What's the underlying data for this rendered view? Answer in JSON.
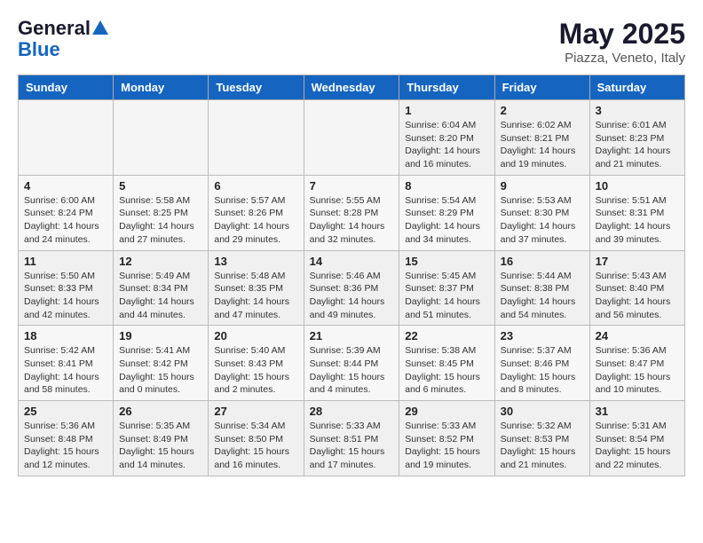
{
  "logo": {
    "line1": "General",
    "line2": "Blue"
  },
  "header": {
    "month": "May 2025",
    "location": "Piazza, Veneto, Italy"
  },
  "days_of_week": [
    "Sunday",
    "Monday",
    "Tuesday",
    "Wednesday",
    "Thursday",
    "Friday",
    "Saturday"
  ],
  "weeks": [
    [
      {
        "day": "",
        "info": ""
      },
      {
        "day": "",
        "info": ""
      },
      {
        "day": "",
        "info": ""
      },
      {
        "day": "",
        "info": ""
      },
      {
        "day": "1",
        "info": "Sunrise: 6:04 AM\nSunset: 8:20 PM\nDaylight: 14 hours\nand 16 minutes."
      },
      {
        "day": "2",
        "info": "Sunrise: 6:02 AM\nSunset: 8:21 PM\nDaylight: 14 hours\nand 19 minutes."
      },
      {
        "day": "3",
        "info": "Sunrise: 6:01 AM\nSunset: 8:23 PM\nDaylight: 14 hours\nand 21 minutes."
      }
    ],
    [
      {
        "day": "4",
        "info": "Sunrise: 6:00 AM\nSunset: 8:24 PM\nDaylight: 14 hours\nand 24 minutes."
      },
      {
        "day": "5",
        "info": "Sunrise: 5:58 AM\nSunset: 8:25 PM\nDaylight: 14 hours\nand 27 minutes."
      },
      {
        "day": "6",
        "info": "Sunrise: 5:57 AM\nSunset: 8:26 PM\nDaylight: 14 hours\nand 29 minutes."
      },
      {
        "day": "7",
        "info": "Sunrise: 5:55 AM\nSunset: 8:28 PM\nDaylight: 14 hours\nand 32 minutes."
      },
      {
        "day": "8",
        "info": "Sunrise: 5:54 AM\nSunset: 8:29 PM\nDaylight: 14 hours\nand 34 minutes."
      },
      {
        "day": "9",
        "info": "Sunrise: 5:53 AM\nSunset: 8:30 PM\nDaylight: 14 hours\nand 37 minutes."
      },
      {
        "day": "10",
        "info": "Sunrise: 5:51 AM\nSunset: 8:31 PM\nDaylight: 14 hours\nand 39 minutes."
      }
    ],
    [
      {
        "day": "11",
        "info": "Sunrise: 5:50 AM\nSunset: 8:33 PM\nDaylight: 14 hours\nand 42 minutes."
      },
      {
        "day": "12",
        "info": "Sunrise: 5:49 AM\nSunset: 8:34 PM\nDaylight: 14 hours\nand 44 minutes."
      },
      {
        "day": "13",
        "info": "Sunrise: 5:48 AM\nSunset: 8:35 PM\nDaylight: 14 hours\nand 47 minutes."
      },
      {
        "day": "14",
        "info": "Sunrise: 5:46 AM\nSunset: 8:36 PM\nDaylight: 14 hours\nand 49 minutes."
      },
      {
        "day": "15",
        "info": "Sunrise: 5:45 AM\nSunset: 8:37 PM\nDaylight: 14 hours\nand 51 minutes."
      },
      {
        "day": "16",
        "info": "Sunrise: 5:44 AM\nSunset: 8:38 PM\nDaylight: 14 hours\nand 54 minutes."
      },
      {
        "day": "17",
        "info": "Sunrise: 5:43 AM\nSunset: 8:40 PM\nDaylight: 14 hours\nand 56 minutes."
      }
    ],
    [
      {
        "day": "18",
        "info": "Sunrise: 5:42 AM\nSunset: 8:41 PM\nDaylight: 14 hours\nand 58 minutes."
      },
      {
        "day": "19",
        "info": "Sunrise: 5:41 AM\nSunset: 8:42 PM\nDaylight: 15 hours\nand 0 minutes."
      },
      {
        "day": "20",
        "info": "Sunrise: 5:40 AM\nSunset: 8:43 PM\nDaylight: 15 hours\nand 2 minutes."
      },
      {
        "day": "21",
        "info": "Sunrise: 5:39 AM\nSunset: 8:44 PM\nDaylight: 15 hours\nand 4 minutes."
      },
      {
        "day": "22",
        "info": "Sunrise: 5:38 AM\nSunset: 8:45 PM\nDaylight: 15 hours\nand 6 minutes."
      },
      {
        "day": "23",
        "info": "Sunrise: 5:37 AM\nSunset: 8:46 PM\nDaylight: 15 hours\nand 8 minutes."
      },
      {
        "day": "24",
        "info": "Sunrise: 5:36 AM\nSunset: 8:47 PM\nDaylight: 15 hours\nand 10 minutes."
      }
    ],
    [
      {
        "day": "25",
        "info": "Sunrise: 5:36 AM\nSunset: 8:48 PM\nDaylight: 15 hours\nand 12 minutes."
      },
      {
        "day": "26",
        "info": "Sunrise: 5:35 AM\nSunset: 8:49 PM\nDaylight: 15 hours\nand 14 minutes."
      },
      {
        "day": "27",
        "info": "Sunrise: 5:34 AM\nSunset: 8:50 PM\nDaylight: 15 hours\nand 16 minutes."
      },
      {
        "day": "28",
        "info": "Sunrise: 5:33 AM\nSunset: 8:51 PM\nDaylight: 15 hours\nand 17 minutes."
      },
      {
        "day": "29",
        "info": "Sunrise: 5:33 AM\nSunset: 8:52 PM\nDaylight: 15 hours\nand 19 minutes."
      },
      {
        "day": "30",
        "info": "Sunrise: 5:32 AM\nSunset: 8:53 PM\nDaylight: 15 hours\nand 21 minutes."
      },
      {
        "day": "31",
        "info": "Sunrise: 5:31 AM\nSunset: 8:54 PM\nDaylight: 15 hours\nand 22 minutes."
      }
    ]
  ]
}
